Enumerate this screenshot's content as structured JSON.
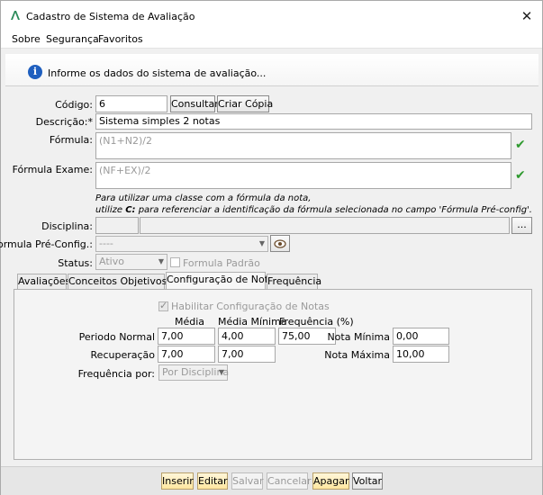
{
  "window": {
    "title": "Cadastro de Sistema de Avaliação",
    "close_glyph": "✕"
  },
  "menu": {
    "items": [
      "Sobre",
      "Segurança",
      "Favoritos"
    ]
  },
  "info": {
    "message": "Informe os dados do sistema de avaliação..."
  },
  "form": {
    "codigo": {
      "label": "Código:",
      "value": "6"
    },
    "consultar_label": "Consultar",
    "criar_copia_label": "Criar Cópia",
    "descricao": {
      "label": "Descrição:*",
      "value": "Sistema simples 2 notas"
    },
    "formula": {
      "label": "Fórmula:",
      "value": "(N1+N2)/2"
    },
    "formula_exame": {
      "label": "Fórmula Exame:",
      "value": "(NF+EX)/2"
    },
    "hint_line1": "Para utilizar uma classe com a fórmula da nota,",
    "hint_line2_prefix": "utilize ",
    "hint_line2_bold": "C:",
    "hint_line2_suffix": " para referenciar a identificação da fórmula selecionada no campo 'Fórmula Pré-config'.",
    "disciplina": {
      "label": "Disciplina:",
      "code": "",
      "name": "",
      "browse_label": "..."
    },
    "formula_preconfig": {
      "label": "Formula Pré-Config.:",
      "value": "----"
    },
    "status": {
      "label": "Status:",
      "value": "Ativo"
    },
    "formula_padrao_label": "Formula Padrão"
  },
  "tabs": [
    "Avaliações",
    "Conceitos Objetivos",
    "Configuração de Notas",
    "Frequência"
  ],
  "active_tab": "Configuração de Notas",
  "config": {
    "habilitar_label": "Habilitar Configuração de Notas",
    "col_media": "Média",
    "col_media_minima": "Média Mínima",
    "col_frequencia": "Frequência (%)",
    "periodo_normal": {
      "label": "Periodo Normal",
      "media": "7,00",
      "media_minima": "4,00",
      "frequencia": "75,00"
    },
    "recuperacao": {
      "label": "Recuperação",
      "media": "7,00",
      "media_minima": "7,00"
    },
    "nota_minima": {
      "label": "Nota Mínima",
      "value": "0,00"
    },
    "nota_maxima": {
      "label": "Nota Máxima",
      "value": "10,00"
    },
    "frequencia_por": {
      "label": "Frequência por:",
      "value": "Por Disciplina"
    }
  },
  "buttons": {
    "inserir": "Inserir",
    "editar": "Editar",
    "salvar": "Salvar",
    "cancelar": "Cancelar",
    "apagar": "Apagar",
    "voltar": "Voltar"
  },
  "colors": {
    "accent_green": "#2f9a2f",
    "highlight_button": "#ffe7a0",
    "info_blue": "#1f5fbf"
  }
}
